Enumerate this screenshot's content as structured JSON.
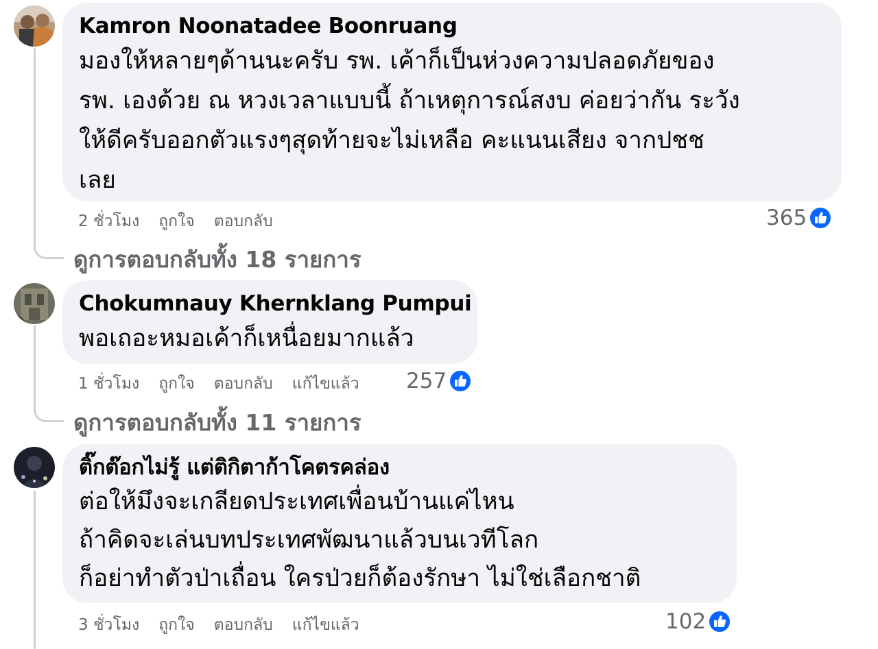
{
  "comments": [
    {
      "author": "Kamron Noonatadee Boonruang",
      "text": "มองให้หลายๆด้านนะครับ รพ. เค้าก็เป็นห่วงความปลอดภัยของ\nรพ. เองด้วย ณ หวงเวลาแบบนี้ ถ้าเหตุการณ์สงบ ค่อยว่ากัน ระวัง\nให้ดีครับออกตัวแรงๆสุดท้ายจะไม่เหลือ คะแนนเสียง จากปชช\nเลย",
      "time": "2 ชั่วโมง",
      "like_label": "ถูกใจ",
      "reply_label": "ตอบกลับ",
      "reaction_count": "365",
      "view_replies": "ดูการตอบกลับทั้ง 18 รายการ",
      "like_icon": "thumbs-up-icon"
    },
    {
      "author": "Chokumnauy Khernklang Pumpui",
      "text": "พอเถอะหมอเค้าก็เหนื่อยมากแล้ว",
      "time": "1 ชั่วโมง",
      "like_label": "ถูกใจ",
      "reply_label": "ตอบกลับ",
      "edited_label": "แก้ไขแล้ว",
      "reaction_count": "257",
      "view_replies": "ดูการตอบกลับทั้ง 11 รายการ",
      "like_icon": "thumbs-up-icon"
    },
    {
      "author": "ติ๊กต๊อกไม่รู้ แต่ติกิตาก้าโคตรคล่อง",
      "text": "ต่อให้มึงจะเกลียดประเทศเพื่อนบ้านแค่ไหน\nถ้าคิดจะเล่นบทประเทศพัฒนาแล้วบนเวทีโลก\nก็อย่าทำตัวป่าเถื่อน ใครป่วยก็ต้องรักษา ไม่ใช่เลือกชาติ",
      "time": "3 ชั่วโมง",
      "like_label": "ถูกใจ",
      "reply_label": "ตอบกลับ",
      "edited_label": "แก้ไขแล้ว",
      "reaction_count": "102",
      "like_icon": "thumbs-up-icon"
    }
  ],
  "colors": {
    "bubble": "#f0f2f5",
    "meta_text": "#65676b",
    "like_blue": "#0866ff",
    "thread_line": "#ced0d4"
  }
}
